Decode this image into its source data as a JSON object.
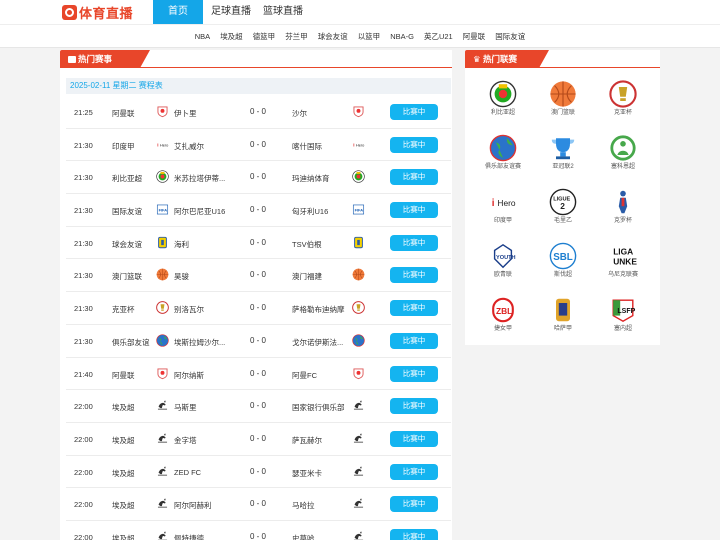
{
  "header": {
    "logo_text": "体育直播",
    "nav": [
      {
        "label": "首页",
        "active": true
      },
      {
        "label": "足球直播",
        "active": false
      },
      {
        "label": "篮球直播",
        "active": false
      }
    ]
  },
  "subnav": [
    "NBA",
    "埃及超",
    "德篮甲",
    "芬兰甲",
    "球会友谊",
    "以篮甲",
    "NBA-G",
    "英乙U21",
    "阿曼联",
    "国际友谊"
  ],
  "hot_matches": {
    "title": "热门赛事",
    "date_line": "2025-02-11 星期二 赛程表",
    "matches": [
      {
        "time": "21:25",
        "league": "阿曼联",
        "home": "伊卜里",
        "score": "0 - 0",
        "away": "沙尔",
        "status": "比赛中",
        "home_icon": "shield-white",
        "away_icon": "shield-white"
      },
      {
        "time": "21:30",
        "league": "印度甲",
        "home": "艾扎威尔",
        "score": "0 - 0",
        "away": "喀什国际",
        "status": "比赛中",
        "home_icon": "ileague",
        "away_icon": "ileague"
      },
      {
        "time": "21:30",
        "league": "利比亚超",
        "home": "米苏拉塔伊蒂...",
        "score": "0 - 0",
        "away": "玛迪纳体育",
        "status": "比赛中",
        "home_icon": "libya",
        "away_icon": "libya"
      },
      {
        "time": "21:30",
        "league": "国际友谊",
        "home": "阿尔巴尼亚U16",
        "score": "0 - 0",
        "away": "匈牙利U16",
        "status": "比赛中",
        "home_icon": "fifa",
        "away_icon": "fifa"
      },
      {
        "time": "21:30",
        "league": "球会友谊",
        "home": "海利",
        "score": "0 - 0",
        "away": "TSV伯根",
        "status": "比赛中",
        "home_icon": "club-yellow",
        "away_icon": "club-yellow"
      },
      {
        "time": "21:30",
        "league": "澳门篮联",
        "home": "昊骏",
        "score": "0 - 0",
        "away": "澳门福建",
        "status": "比赛中",
        "home_icon": "basketball",
        "away_icon": "basketball"
      },
      {
        "time": "21:30",
        "league": "克亚杯",
        "home": "别洛瓦尔",
        "score": "0 - 0",
        "away": "萨格勒布迪纳摩",
        "status": "比赛中",
        "home_icon": "croatia-cup",
        "away_icon": "croatia-cup"
      },
      {
        "time": "21:30",
        "league": "俱乐部友谊",
        "home": "埃斯拉姆沙尔...",
        "score": "0 - 0",
        "away": "戈尔诺伊斯法...",
        "status": "比赛中",
        "home_icon": "globe",
        "away_icon": "globe"
      },
      {
        "time": "21:40",
        "league": "阿曼联",
        "home": "阿尔纳斯",
        "score": "0 - 0",
        "away": "阿曼FC",
        "status": "比赛中",
        "home_icon": "shield-white",
        "away_icon": "shield-white"
      },
      {
        "time": "22:00",
        "league": "埃及超",
        "home": "马斯里",
        "score": "0 - 0",
        "away": "国家银行俱乐部",
        "status": "比赛中",
        "home_icon": "egypt",
        "away_icon": "egypt"
      },
      {
        "time": "22:00",
        "league": "埃及超",
        "home": "金字塔",
        "score": "0 - 0",
        "away": "萨瓦赫尔",
        "status": "比赛中",
        "home_icon": "egypt",
        "away_icon": "egypt"
      },
      {
        "time": "22:00",
        "league": "埃及超",
        "home": "ZED FC",
        "score": "0 - 0",
        "away": "瑟亚米卡",
        "status": "比赛中",
        "home_icon": "egypt",
        "away_icon": "egypt"
      },
      {
        "time": "22:00",
        "league": "埃及超",
        "home": "阿尔阿赫利",
        "score": "0 - 0",
        "away": "马哈拉",
        "status": "比赛中",
        "home_icon": "egypt",
        "away_icon": "egypt"
      },
      {
        "time": "22:00",
        "league": "埃及超",
        "home": "佩特捷德",
        "score": "0 - 0",
        "away": "史莫哈",
        "status": "比赛中",
        "home_icon": "egypt",
        "away_icon": "egypt"
      }
    ]
  },
  "hot_leagues": {
    "title": "热门联赛",
    "items": [
      {
        "name": "利比亚超",
        "icon": "libya"
      },
      {
        "name": "澳门篮联",
        "icon": "basketball"
      },
      {
        "name": "克亚杯",
        "icon": "croatia-cup"
      },
      {
        "name": "俱乐部友谊赛",
        "icon": "globe"
      },
      {
        "name": "亚冠联2",
        "icon": "trophy"
      },
      {
        "name": "塞科恩超",
        "icon": "green-ring"
      },
      {
        "name": "印度甲",
        "icon": "ileague"
      },
      {
        "name": "毛里乙",
        "icon": "ligue2"
      },
      {
        "name": "克罗杯",
        "icon": "player"
      },
      {
        "name": "欧青联",
        "icon": "uefa-youth"
      },
      {
        "name": "斯伐超",
        "icon": "sbl"
      },
      {
        "name": "乌尼克联赛",
        "icon": "liga-unke"
      },
      {
        "name": "捷女甲",
        "icon": "zbl"
      },
      {
        "name": "哈萨甲",
        "icon": "kaz"
      },
      {
        "name": "塞内超",
        "icon": "lsfp"
      }
    ]
  },
  "colors": {
    "accent": "#e8462a",
    "primary": "#14a6e8",
    "button": "#14b4f0"
  }
}
